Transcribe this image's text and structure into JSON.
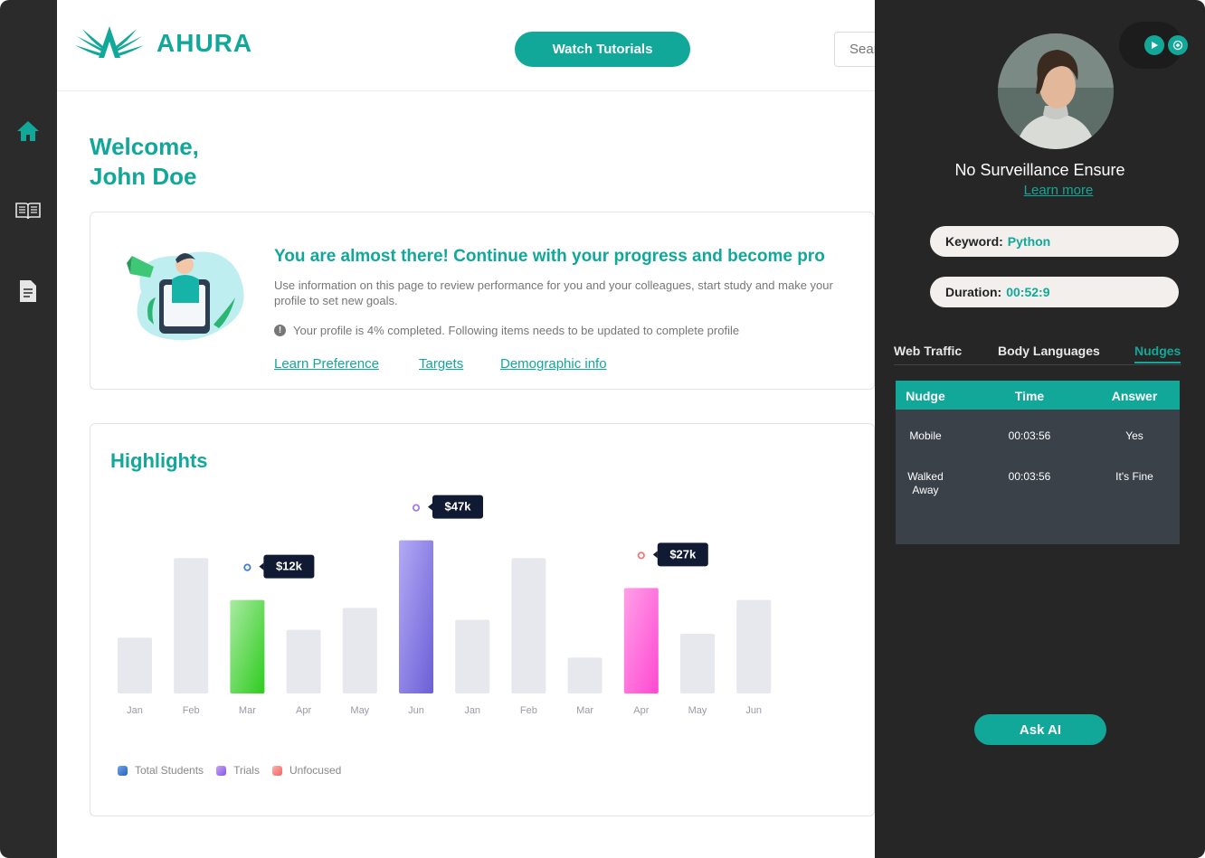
{
  "brand": {
    "name": "AHURA",
    "accent": "#11a89a"
  },
  "header": {
    "watch_label": "Watch Tutorials",
    "search_placeholder": "Search"
  },
  "sidebar": {
    "items": [
      {
        "icon": "home-icon"
      },
      {
        "icon": "book-icon"
      },
      {
        "icon": "document-icon"
      }
    ]
  },
  "welcome": {
    "line1": "Welcome,",
    "line2": "John Doe"
  },
  "progress": {
    "title": "You are almost there! Continue with your progress and become pro",
    "description": "Use information on this page to review performance for you and your colleagues, start study and make your profile to set new goals.",
    "status": "Your profile is 4% completed. Following items needs to be updated to complete profile",
    "links": [
      "Learn Preference",
      "Targets",
      "Demographic info"
    ]
  },
  "highlights": {
    "title": "Highlights"
  },
  "chart_data": {
    "type": "bar",
    "categories": [
      "Jan",
      "Feb",
      "Mar",
      "Apr",
      "May",
      "Jun",
      "Jan",
      "Feb",
      "Mar",
      "Apr",
      "May",
      "Jun"
    ],
    "values": [
      28,
      68,
      47,
      32,
      43,
      77,
      37,
      68,
      18,
      53,
      30,
      47
    ],
    "highlighted": [
      {
        "index": 2,
        "series": "Total Students",
        "color": "#3ccb2e",
        "label": "$12k"
      },
      {
        "index": 5,
        "series": "Trials",
        "color": "#8b7fe6",
        "label": "$47k"
      },
      {
        "index": 9,
        "series": "Unfocused",
        "color": "#ff5fd8",
        "label": "$27k"
      }
    ],
    "ylim": [
      0,
      100
    ],
    "grid": false,
    "legend": [
      {
        "name": "Total Students",
        "color": "#3b7ad6"
      },
      {
        "name": "Trials",
        "color": "#a179ef"
      },
      {
        "name": "Unfocused",
        "color": "#f27a7a"
      }
    ],
    "legend_position": "bottom-left"
  },
  "right_panel": {
    "title": "No Surveillance Ensure",
    "learn_more": "Learn more",
    "keyword_label": "Keyword:",
    "keyword_value": "Python",
    "duration_label": "Duration:",
    "duration_value": "00:52:9",
    "tabs": [
      "Web Traffic",
      "Body Languages",
      "Nudges"
    ],
    "active_tab": "Nudges",
    "table": {
      "headers": [
        "Nudge",
        "Time",
        "Answer"
      ],
      "rows": [
        {
          "nudge": "Mobile",
          "time": "00:03:56",
          "answer": "Yes"
        },
        {
          "nudge": "Walked Away",
          "time": "00:03:56",
          "answer": "It's Fine"
        }
      ]
    },
    "ask_label": "Ask AI"
  }
}
